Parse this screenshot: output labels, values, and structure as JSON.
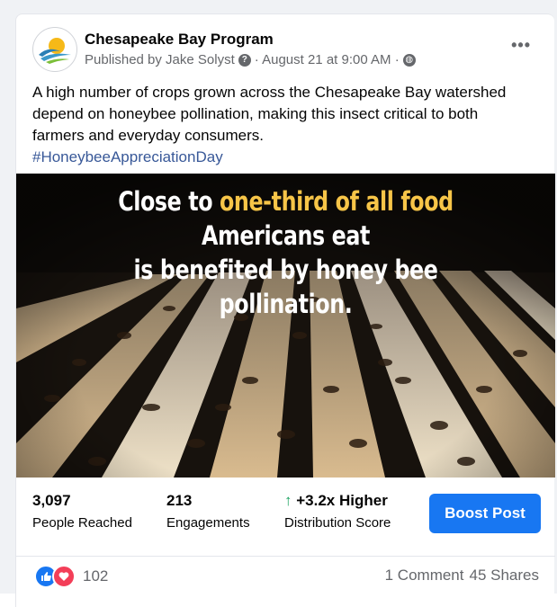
{
  "post": {
    "page_name": "Chesapeake Bay Program",
    "published_by": "Published by Jake Solyst",
    "date": "· August 21 at 9:00 AM ·",
    "caption": "A high number of crops grown across the Chesapeake Bay watershed depend on honeybee pollination, making this insect critical to both farmers and everyday consumers.",
    "hashtag": "#HoneybeeAppreciationDay",
    "more_label": "•••"
  },
  "image": {
    "headline_part1": "Close to ",
    "headline_highlight": "one-third of all food",
    "headline_part2": " Americans eat",
    "headline_line2": "is benefited by honey bee pollination."
  },
  "stats": {
    "reached_value": "3,097",
    "reached_label": "People Reached",
    "engagements_value": "213",
    "engagements_label": "Engagements",
    "distribution_value": "+3.2x Higher",
    "distribution_label": "Distribution Score",
    "arrow": "↑",
    "boost_label": "Boost Post"
  },
  "footer": {
    "reaction_count": "102",
    "comments": "1 Comment",
    "shares": "45 Shares"
  },
  "colors": {
    "accent": "#1877f2",
    "highlight": "#f7c548",
    "positive": "#1aa260"
  }
}
